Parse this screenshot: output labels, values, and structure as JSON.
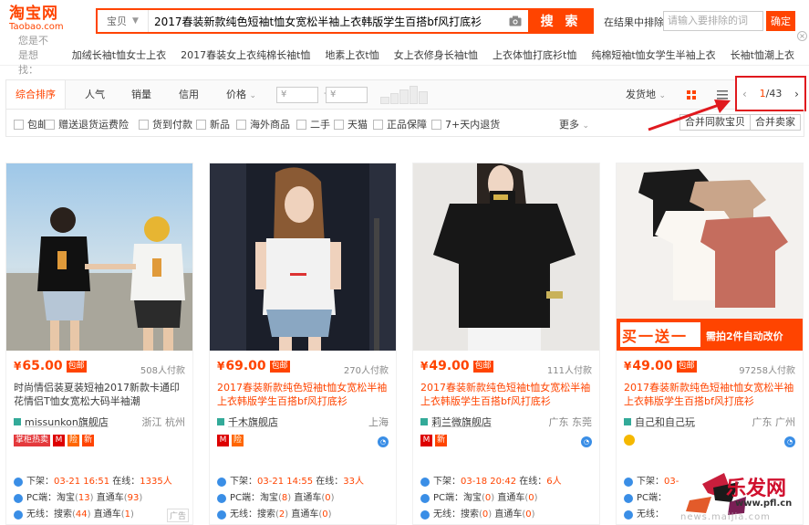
{
  "header": {
    "logo_cn": "淘宝网",
    "logo_en": "Taobao.com",
    "search_type": "宝贝",
    "search_query": "2017春装新款纯色短袖t恤女宽松半袖上衣韩版学生百搭bf风打底衫",
    "search_button": "搜 索",
    "in_result_label": "在结果中排除",
    "in_result_placeholder": "请输入要排除的词",
    "confirm_label": "确定",
    "close_glyph": "×"
  },
  "suggest": {
    "label": "您是不是想找：",
    "items": [
      "加绒长袖t恤女士上衣",
      "2017春装女上衣纯棉长袖t恤",
      "地素上衣t恤",
      "女上衣修身长袖t恤",
      "上衣体恤打底衫t恤",
      "纯棉短袖t恤女学生半袖上衣",
      "长袖t恤潮上衣"
    ]
  },
  "sortbar": {
    "items": [
      "综合排序",
      "人气",
      "销量",
      "信用",
      "价格"
    ],
    "price_from": "¥",
    "price_to": "¥",
    "price_dash": "-",
    "ship_from": "发货地",
    "page_current": "1",
    "page_total": "/43",
    "prev": "‹",
    "next": "›"
  },
  "filters": {
    "items": [
      "包邮",
      "赠送退货运费险",
      "货到付款",
      "新品",
      "海外商品",
      "二手",
      "天猫",
      "正品保障",
      "7+天内退货"
    ],
    "more": "更多",
    "merge_same": "合并同款宝贝",
    "merge_seller": "合并卖家"
  },
  "products": [
    {
      "price": "65.00",
      "baoyou": "包邮",
      "buyers": "508人付款",
      "title": "时尚情侣装夏装短袖2017新款卡通印花情侣T恤女宽松大码半袖潮",
      "shop": "missunkon旗舰店",
      "location": "浙江 杭州",
      "badge1": "掌柜热卖",
      "time": "03-21 16:51",
      "online": "1335人",
      "pc_taobao": "13",
      "pc_zhitong": "93",
      "mobile_search": "44",
      "mobile_zhitong": "1",
      "ad": "广告"
    },
    {
      "price": "69.00",
      "baoyou": "包邮",
      "buyers": "270人付款",
      "title": "2017春装新款纯色短袖t恤女宽松半袖上衣韩版学生百搭bf风打底衫",
      "shop": "千木旗舰店",
      "location": "上海",
      "time": "03-21 14:55",
      "online": "33人",
      "pc_taobao": "8",
      "pc_zhitong": "0",
      "mobile_search": "2",
      "mobile_zhitong": "0"
    },
    {
      "price": "49.00",
      "baoyou": "包邮",
      "buyers": "111人付款",
      "title": "2017春装新款纯色短袖t恤女宽松半袖上衣韩版学生百搭bf风打底衫",
      "shop": "莉兰微旗舰店",
      "location": "广东 东莞",
      "time": "03-18 20:42",
      "online": "6人",
      "pc_taobao": "0",
      "pc_zhitong": "0",
      "mobile_search": "0",
      "mobile_zhitong": "0"
    },
    {
      "price": "49.00",
      "baoyou": "包邮",
      "buyers": "97258人付款",
      "title": "2017春装新款纯色短袖t恤女宽松半袖上衣韩版学生百搭bf风打底衫",
      "shop": "自己和自己玩",
      "location": "广东 广州",
      "banner_left": "买一送一",
      "banner_right": "需拍2件自动改价",
      "time": "03-",
      "online": "",
      "pc_taobao": "",
      "pc_zhitong": "",
      "mobile_search": "",
      "mobile_zhitong": ""
    }
  ],
  "labels": {
    "yen": "¥",
    "shelf": "下架：",
    "online": "在线：",
    "pc": "PC端：",
    "taobao": "淘宝",
    "zhitong": "直通车",
    "mobile": "无线：",
    "search": "搜索"
  },
  "watermark": {
    "text": "乐发网",
    "url": "www.pfl.cn",
    "url2": "news.maijia.com"
  },
  "colors": {
    "brand": "#ff4400",
    "annotation": "#e0191e"
  }
}
